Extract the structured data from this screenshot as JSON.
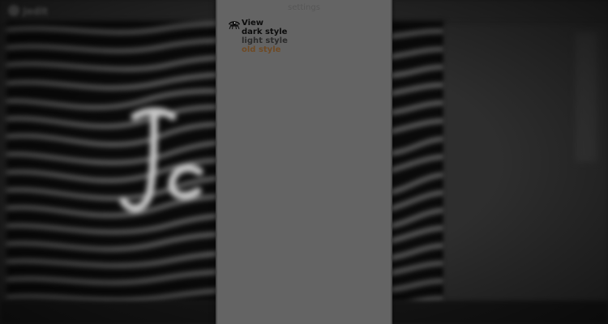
{
  "settings": {
    "title": "settings",
    "view_group": {
      "heading": "View",
      "icon": "eye-icon",
      "options": [
        {
          "label": "dark style",
          "color": "#0c0c0c"
        },
        {
          "label": "light style",
          "color": "#2c2c2c"
        },
        {
          "label": "old style",
          "color": "#6e4a25"
        }
      ]
    }
  },
  "background_app": {
    "title": "Jedit"
  }
}
